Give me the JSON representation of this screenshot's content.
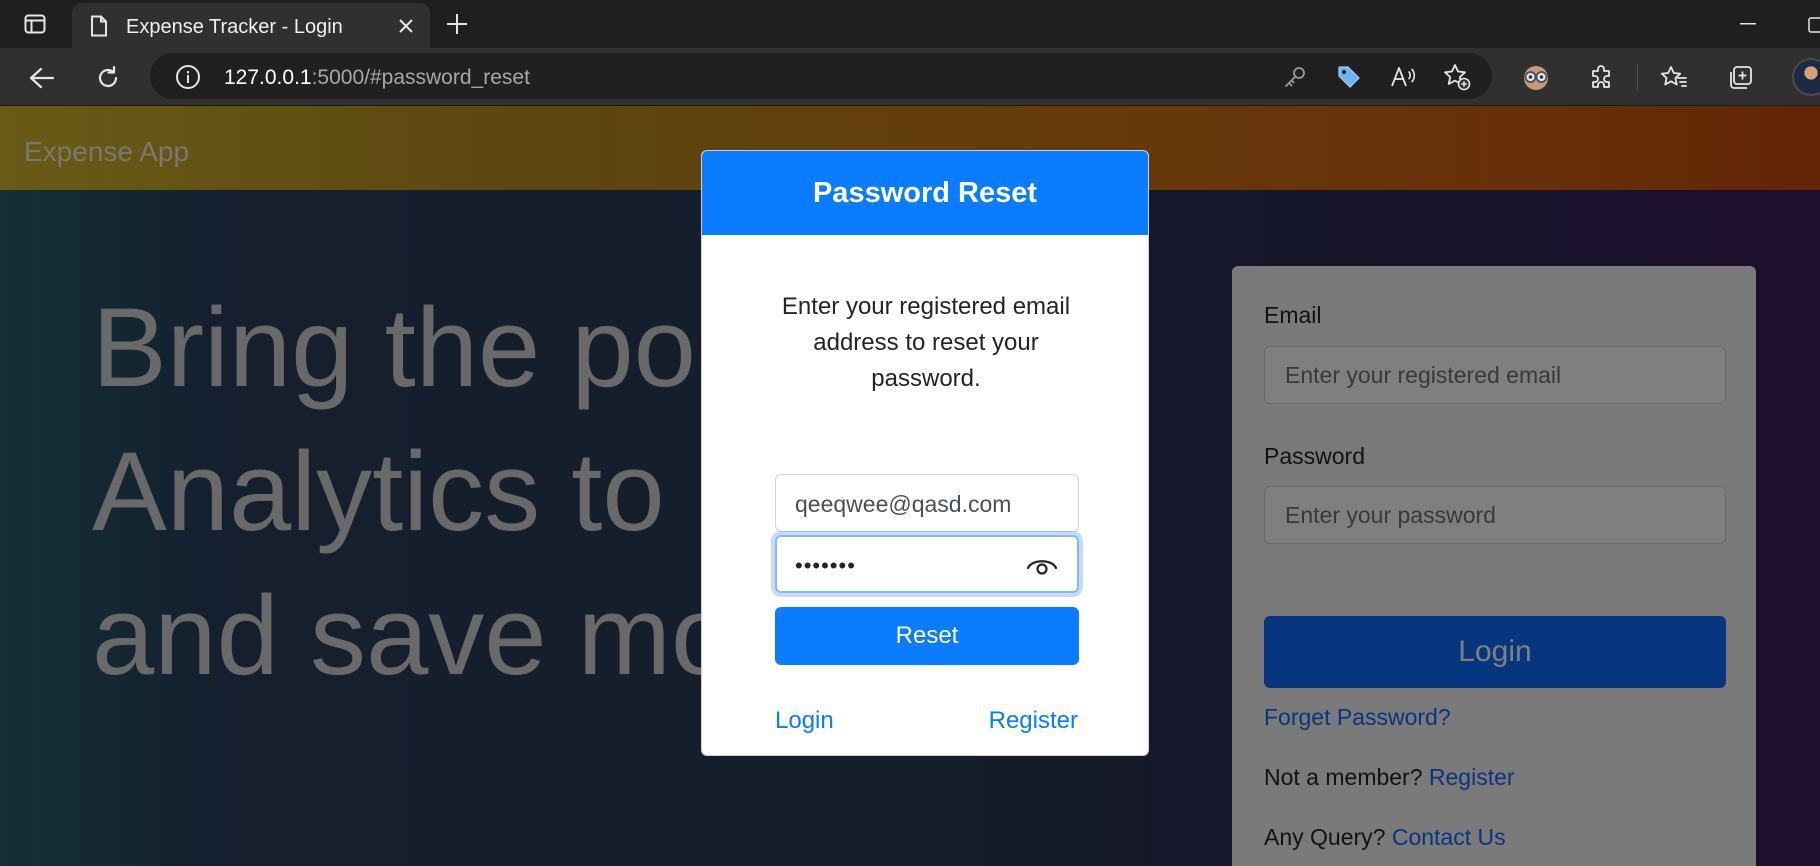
{
  "browser": {
    "tab_title": "Expense Tracker - Login",
    "url_host": "127.0.0.1",
    "url_rest": ":5000/#password_reset"
  },
  "icons": {
    "tab_actions": "tab-actions-icon",
    "tab_page": "document-icon",
    "tab_close": "close-icon",
    "new_tab": "plus-icon",
    "minimize": "minimize-icon",
    "maximize": "maximize-icon",
    "back": "back-arrow-icon",
    "refresh": "refresh-icon",
    "site_info": "info-icon",
    "password_key": "key-icon",
    "coupon": "tag-icon",
    "read_aloud": "read-aloud-icon",
    "add_favorite": "star-add-icon",
    "extension_copilot": "goggles-icon",
    "extensions": "puzzle-icon",
    "favorites": "favorites-star-icon",
    "collections": "collections-icon",
    "profile": "avatar",
    "show_password": "eye-icon"
  },
  "app": {
    "brand": "Expense App",
    "hero_lines": [
      "Bring the po",
      "Analytics to",
      "and save mo"
    ]
  },
  "login_form": {
    "email_label": "Email",
    "email_placeholder": "Enter your registered email",
    "password_label": "Password",
    "password_placeholder": "Enter your password",
    "login_button": "Login",
    "forgot_link": "Forget Password?",
    "not_member_text": "Not a member?",
    "register_link": "Register",
    "query_text": "Any Query?",
    "contact_link": "Contact Us"
  },
  "modal": {
    "title": "Password Reset",
    "description": "Enter your registered email address to reset your password.",
    "email_value": "qeeqwee@qasd.com",
    "password_mask": "•••••••",
    "reset_button": "Reset",
    "login_link": "Login",
    "register_link": "Register"
  },
  "colors": {
    "primary": "#0a7cff",
    "navbar_start": "#d2b62e",
    "navbar_end": "#c44b0a"
  }
}
